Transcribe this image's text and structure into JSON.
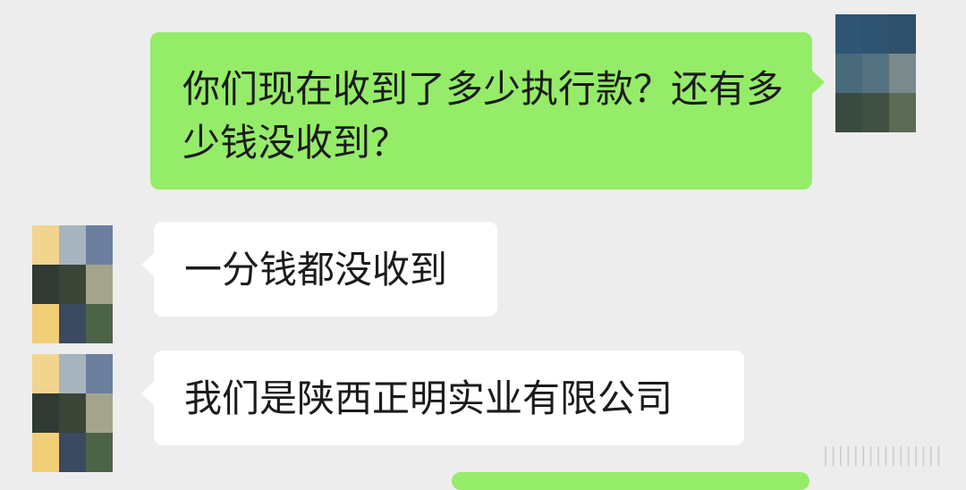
{
  "messages": [
    {
      "direction": "out",
      "text": "你们现在收到了多少执行款？还有多少钱没收到？"
    },
    {
      "direction": "in",
      "text": "一分钱都没收到"
    },
    {
      "direction": "in",
      "text": "我们是陕西正明实业有限公司"
    }
  ],
  "colors": {
    "background": "#ededed",
    "outgoing_bubble": "#95ec69",
    "incoming_bubble": "#ffffff"
  },
  "avatars": {
    "self_pixelated": [
      "#2f5674",
      "#2e5472",
      "#2d506b",
      "#496a7a",
      "#54727f",
      "#7a8a8c",
      "#3a4a3f",
      "#3f4f41",
      "#5b6a55"
    ],
    "contact_pixelated": [
      "#f2d48e",
      "#a7b4bd",
      "#6b7f9f",
      "#2f3a33",
      "#3a4437",
      "#a2a58c",
      "#f1ce78",
      "#3c4a61",
      "#4c6347"
    ]
  }
}
